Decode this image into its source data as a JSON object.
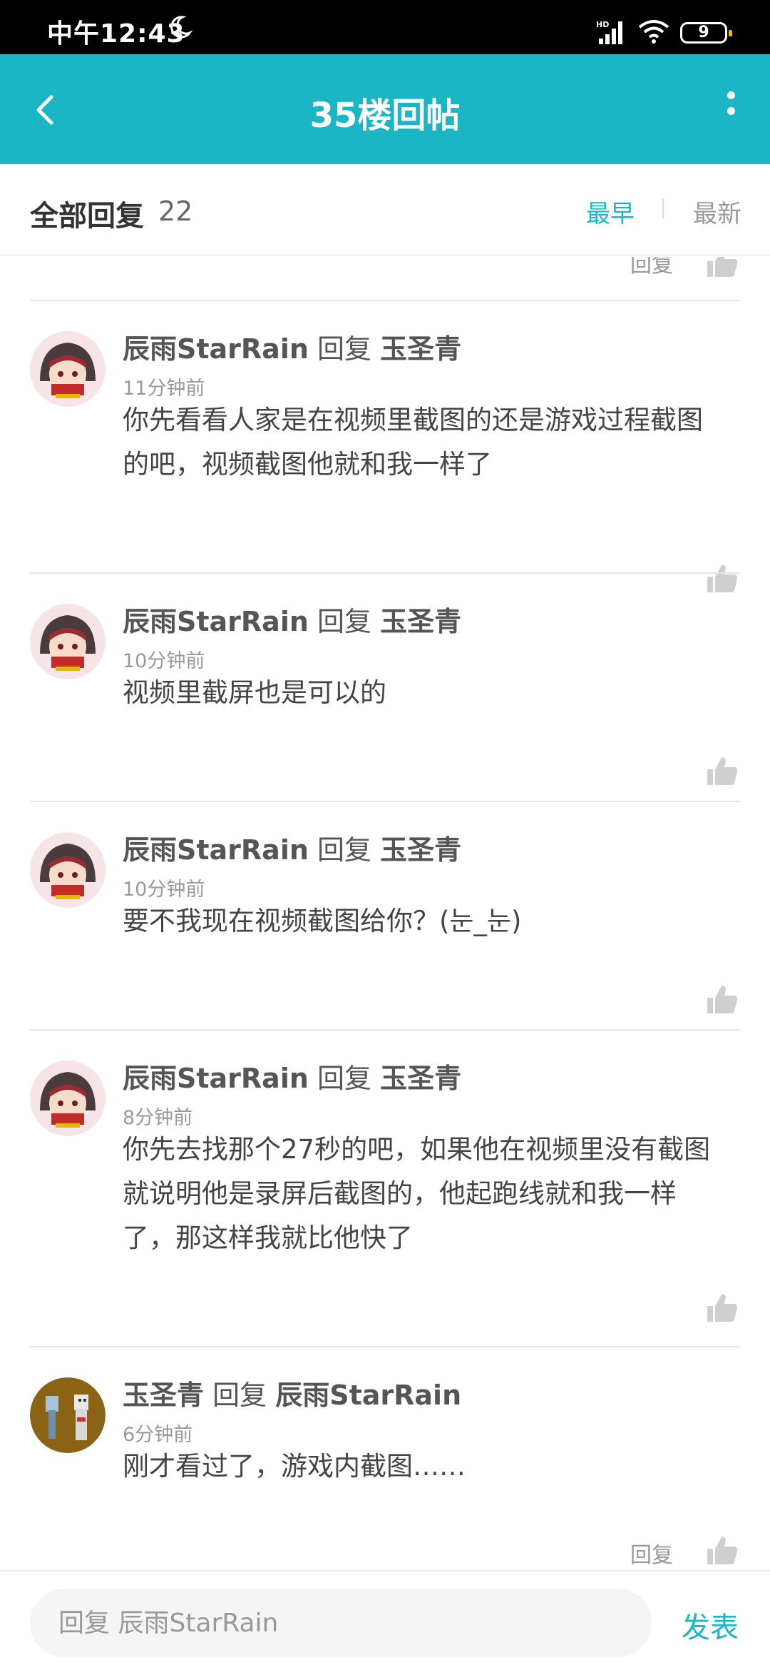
{
  "status_bar": {
    "time": "中午12:43",
    "network": "HD",
    "battery": "9"
  },
  "header": {
    "title": "35楼回帖"
  },
  "reply_header": {
    "title": "全部回复",
    "count": "22",
    "sort_earliest": "最早",
    "sort_newest": "最新"
  },
  "prev_item": {
    "reply_label": "回复"
  },
  "comments": [
    {
      "user": "辰雨StarRain",
      "reply_word": "回复",
      "target": "玉圣青",
      "time": "11分钟前",
      "text_lines": [
        "你先看看人家是在视频里截图的还是游戏过程截图",
        "的吧，视频截图他就和我一样了"
      ]
    },
    {
      "user": "辰雨StarRain",
      "reply_word": "回复",
      "target": "玉圣青",
      "time": "10分钟前",
      "text_lines": [
        "视频里截屏也是可以的"
      ]
    },
    {
      "user": "辰雨StarRain",
      "reply_word": "回复",
      "target": "玉圣青",
      "time": "10分钟前",
      "text_lines": [
        "要不我现在视频截图给你？(눈_눈)"
      ]
    },
    {
      "user": "辰雨StarRain",
      "reply_word": "回复",
      "target": "玉圣青",
      "time": "8分钟前",
      "text_lines": [
        "你先去找那个27秒的吧，如果他在视频里没有截图",
        "就说明他是录屏后截图的，他起跑线就和我一样",
        "了，那这样我就比他快了"
      ]
    },
    {
      "user": "玉圣青",
      "reply_word": "回复",
      "target": "辰雨StarRain",
      "time": "6分钟前",
      "text_lines": [
        "刚才看过了，游戏内截图……"
      ],
      "reply_label": "回复"
    }
  ],
  "bottom_bar": {
    "placeholder": "回复 辰雨StarRain",
    "send_label": "发表"
  },
  "colors": {
    "accent": "#1ab6c6",
    "status_bar": "#000000"
  }
}
